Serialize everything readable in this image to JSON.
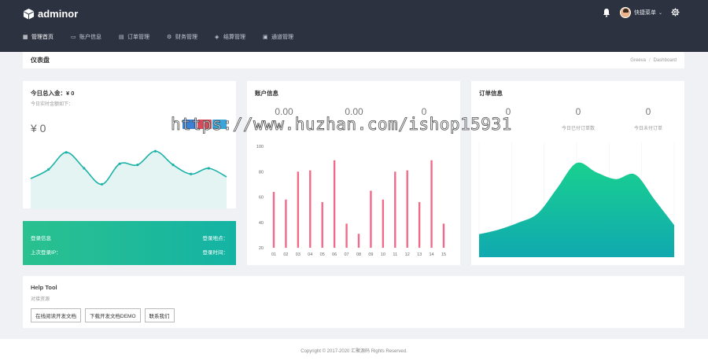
{
  "app": {
    "logo_text": "adminor"
  },
  "header": {
    "user_name": "快捷菜单"
  },
  "nav": [
    {
      "label": "管理首页",
      "icon": "grid-icon",
      "active": true
    },
    {
      "label": "账户信息",
      "icon": "card-icon"
    },
    {
      "label": "订单管理",
      "icon": "list-icon"
    },
    {
      "label": "财务管理",
      "icon": "gear-icon"
    },
    {
      "label": "结算管理",
      "icon": "layers-icon"
    },
    {
      "label": "通道管理",
      "icon": "window-icon"
    }
  ],
  "pagebar": {
    "title": "仪表盘",
    "crumb1": "Greeva",
    "crumb2": "Dashboard"
  },
  "income": {
    "title": "今日总入金：¥ 0",
    "subtitle": "今日实时金额如下：",
    "amount": "¥ 0",
    "sparkline": [
      22,
      38,
      68,
      40,
      12,
      48,
      46,
      70,
      46,
      30,
      40,
      25
    ]
  },
  "login": {
    "info_label": "登录信息",
    "location_label": "登录地点：",
    "last_login_label": "上次登录IP：",
    "time_label": "登录时间："
  },
  "account": {
    "title": "账户信息",
    "stats": [
      "0.00",
      "0.00",
      "0"
    ],
    "labels": [
      "",
      "",
      ""
    ]
  },
  "orders": {
    "title": "订单信息",
    "stats": [
      "0",
      "0",
      "0"
    ],
    "labels": [
      "",
      "今日已付订单数",
      "今日未付订单"
    ]
  },
  "help": {
    "title": "Help Tool",
    "subtitle": "对接资源",
    "buttons": [
      "在线阅读开发文档",
      "下载开发文档DEMO",
      "联系我们"
    ]
  },
  "footer": {
    "text": "Copyright © 2017-2020 汇聚源码 Rights Reserved."
  },
  "watermark": {
    "text": "https://www.huzhan.com/ishop15931"
  },
  "chart_data": [
    {
      "type": "bar",
      "categories": [
        "01",
        "02",
        "03",
        "04",
        "05",
        "06",
        "07",
        "08",
        "09",
        "10",
        "11",
        "12",
        "13",
        "14",
        "15"
      ],
      "values": [
        64,
        58,
        80,
        81,
        56,
        89,
        39,
        31,
        65,
        58,
        80,
        81,
        56,
        89,
        39
      ],
      "ylim": [
        20,
        100
      ],
      "yticks": [
        20,
        40,
        60,
        80,
        100
      ],
      "color": "#f06b8a",
      "grid": false
    },
    {
      "type": "area",
      "x": [
        0,
        1,
        2,
        3,
        4,
        5,
        6,
        7,
        8,
        9,
        10
      ],
      "values": [
        20,
        24,
        30,
        38,
        60,
        82,
        74,
        68,
        72,
        50,
        28
      ],
      "color_top": "#19d08f",
      "color_bottom": "#10a9b0",
      "grid": true
    }
  ],
  "colors": {
    "topbar": "#2c3240",
    "sparkline_stroke": "#1cb2a8",
    "sparkline_fill": "#e3f4f3",
    "bar": "#f06b8a"
  }
}
